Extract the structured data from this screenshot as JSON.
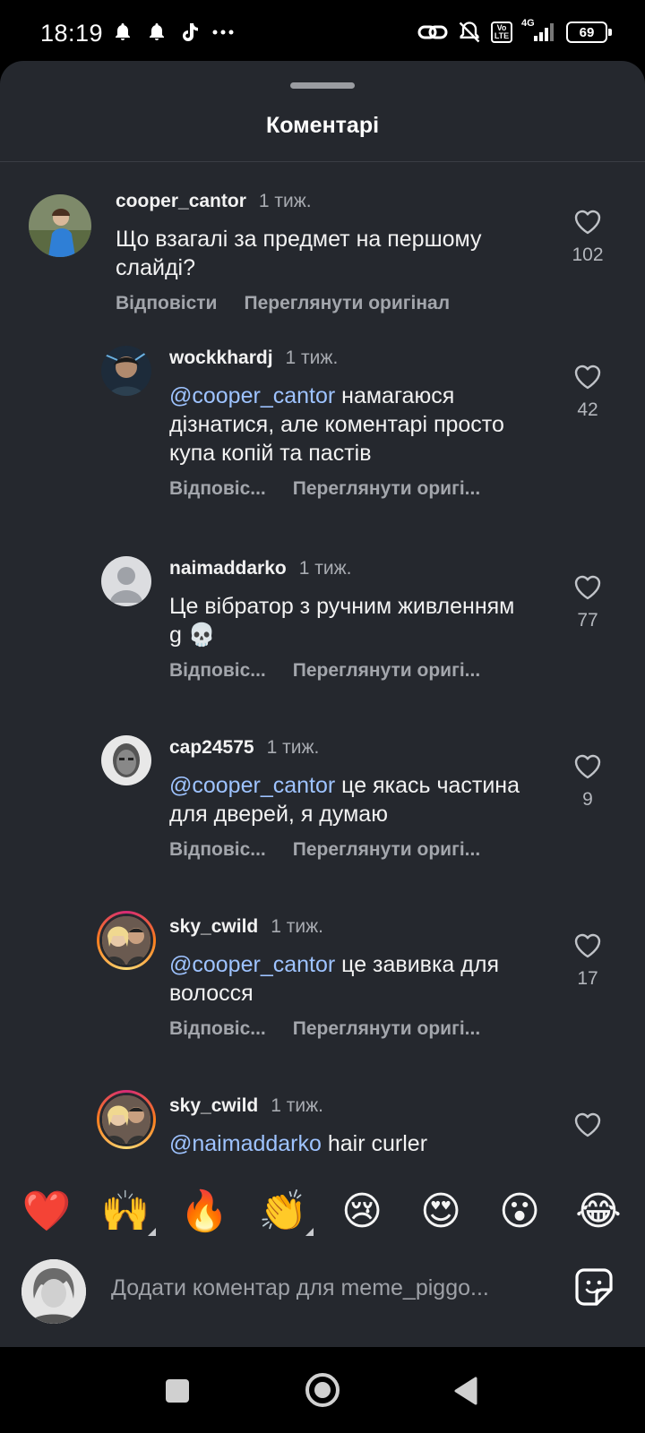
{
  "status_bar": {
    "time": "18:19",
    "left_icons": [
      "bell-icon",
      "bell-icon",
      "tiktok-icon",
      "more-dots-icon"
    ],
    "right_icons": [
      "link-icon",
      "bell-off-icon",
      "volte-icon",
      "signal-icon",
      "battery-icon"
    ],
    "volte_top": "Vo",
    "volte_bottom": "LTE",
    "network": "4G",
    "battery": "69"
  },
  "sheet": {
    "title": "Коментарі"
  },
  "comments": [
    {
      "username": "cooper_cantor",
      "time": "1 тиж.",
      "mention": "",
      "text": "Що взагалі за предмет на першому слайді?",
      "reply_label": "Відповісти",
      "view_original_label": "Переглянути оригінал",
      "likes": "102"
    },
    {
      "username": "wockkhardj",
      "time": "1 тиж.",
      "mention": "@cooper_cantor",
      "text": " намагаюся дізнатися, але коментарі просто купа копій та пастів",
      "reply_label": "Відповіс...",
      "view_original_label": "Переглянути оригі...",
      "likes": "42"
    },
    {
      "username": "naimaddarko",
      "time": "1 тиж.",
      "mention": "",
      "text": "Це вібратор з ручним живленням g 💀",
      "reply_label": "Відповіс...",
      "view_original_label": "Переглянути оригі...",
      "likes": "77"
    },
    {
      "username": "cap24575",
      "time": "1 тиж.",
      "mention": "@cooper_cantor",
      "text": " це якась частина для дверей, я думаю",
      "reply_label": "Відповіс...",
      "view_original_label": "Переглянути оригі...",
      "likes": "9"
    },
    {
      "username": "sky_cwild",
      "time": "1 тиж.",
      "mention": "@cooper_cantor",
      "text": " це завивка для волосся",
      "reply_label": "Відповіс...",
      "view_original_label": "Переглянути оригі...",
      "likes": "17"
    },
    {
      "username": "sky_cwild",
      "time": "1 тиж.",
      "mention": "@naimaddarko",
      "text": " hair curler",
      "reply_label": "",
      "view_original_label": "",
      "likes": ""
    }
  ],
  "emoji_bar": [
    "❤️",
    "🙌",
    "🔥",
    "👏",
    "😢",
    "😍",
    "😮",
    "😂"
  ],
  "input": {
    "placeholder": "Додати коментар для meme_piggo..."
  },
  "colors": {
    "sheet_bg": "#25282e",
    "mention": "#9ec3ff",
    "muted_text": "#a3a6ac"
  }
}
